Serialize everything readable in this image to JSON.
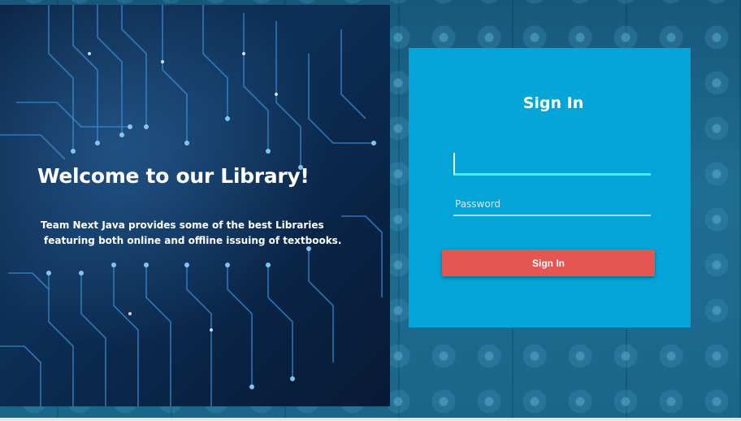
{
  "welcome": {
    "title": "Welcome to our Library!",
    "description_line1": "Team Next Java provides some of the best Libraries",
    "description_line2": "featuring both online and offline issuing of textbooks."
  },
  "signin": {
    "heading": "Sign In",
    "username_value": "",
    "password_placeholder": "Password",
    "button_label": "Sign In"
  },
  "colors": {
    "card_background": "#03a5d8",
    "button_background": "#e35652",
    "field_focus_underline": "#4fe6ff",
    "left_panel_background": "#0a2446"
  },
  "icons": {
    "left_panel_art": "circuit-board-image",
    "page_background": "snowflake-pattern"
  }
}
